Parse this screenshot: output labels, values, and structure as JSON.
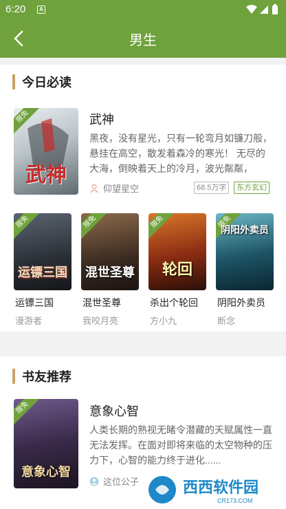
{
  "status": {
    "time": "6:20",
    "notif_icon": "A"
  },
  "appbar": {
    "title": "男生"
  },
  "today": {
    "heading": "今日必读",
    "featured": {
      "badge": "限免",
      "cover_title": "武神",
      "title": "武神",
      "desc": "黑夜，没有星光，只有一轮弯月如镰刀般，悬挂在高空，散发着森冷的寒光！ 无尽的大海，倒映着天上的冷月，波光粼粼， 海...",
      "author": "仰望星空",
      "words": "68.5万字",
      "genre": "东方玄幻"
    },
    "books": [
      {
        "badge": "限免",
        "cover_title": "运镖三国",
        "title": "运镖三国",
        "author": "漫游者"
      },
      {
        "badge": "限免",
        "cover_title": "混世圣尊",
        "title": "混世圣尊",
        "author": "我咬月亮"
      },
      {
        "badge": "限免",
        "cover_title": "轮回",
        "title": "杀出个轮回",
        "author": "方小九"
      },
      {
        "badge": "限免",
        "cover_title": "阴阳外卖员",
        "title": "阴阳外卖员",
        "author": "断念"
      }
    ]
  },
  "recommend": {
    "heading": "书友推荐",
    "featured": {
      "badge": "限免",
      "cover_title": "意象心智",
      "title": "意象心智",
      "desc": "人类长期的熟视无睹令潜藏的天赋属性一直无法发挥。在面对即将来临的太空物种的压力下，心智的能力终于进化......",
      "author": "这位公子"
    }
  },
  "watermark": {
    "text": "西西软件园",
    "sub": "CR173.COM"
  },
  "colors": {
    "brand": "#6fa23c",
    "accent_bar": "#c8a36a"
  }
}
